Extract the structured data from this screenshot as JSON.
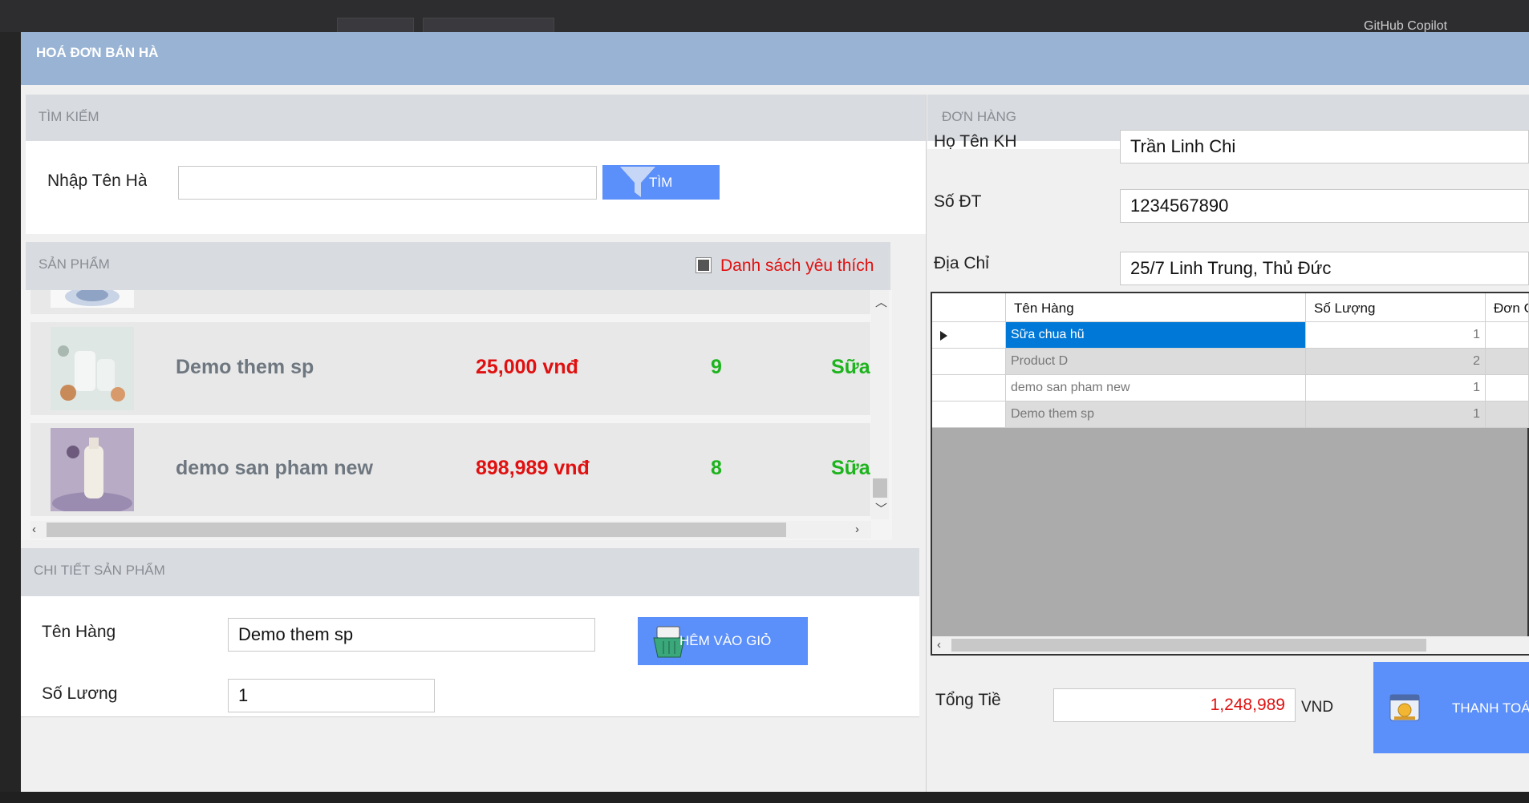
{
  "window": {
    "title": "HOÁ ĐƠN BÁN HÀ"
  },
  "search": {
    "section_title": "TÌM KIẾM",
    "label": "Nhập Tên Hà",
    "input_value": "",
    "button_label": "TÌM"
  },
  "products": {
    "section_title": "SẢN PHẨM",
    "favorites_label": "Danh sách yêu thích",
    "items": [
      {
        "name": "Demo them sp",
        "price": "25,000 vnđ",
        "qty": "9",
        "category": "Sữa"
      },
      {
        "name": "demo san pham new",
        "price": "898,989 vnđ",
        "qty": "8",
        "category": "Sữa"
      }
    ]
  },
  "details": {
    "section_title": "CHI TIẾT SẢN PHẨM",
    "name_label": "Tên Hàng",
    "name_value": "Demo them sp",
    "qty_label": "Số Lương",
    "qty_value": "1",
    "add_button_label": "HÊM VÀO GIỎ"
  },
  "order": {
    "section_title": "ĐƠN HÀNG",
    "customer_label": "Họ Tên KH",
    "customer_value": "Trần Linh Chi",
    "phone_label": "Số ĐT",
    "phone_value": "1234567890",
    "address_label": "Địa Chỉ",
    "address_value": "25/7 Linh Trung, Thủ Đức",
    "grid": {
      "columns": [
        "Tên Hàng",
        "Số Lượng",
        "Đơn G"
      ],
      "rows": [
        {
          "name": "Sữa chua hũ",
          "qty": "1"
        },
        {
          "name": "Product D",
          "qty": "2"
        },
        {
          "name": "demo san pham new",
          "qty": "1"
        },
        {
          "name": "Demo them sp",
          "qty": "1"
        }
      ]
    },
    "total_label": "Tổng Tiề",
    "total_value": "1,248,989",
    "currency": "VND",
    "pay_button_label": "THANH TOÁ"
  },
  "colors": {
    "titlebar": "#98b3d4",
    "accent_button": "#5b8ff9",
    "price_red": "#e01010",
    "qty_green": "#1db31d",
    "grid_selection": "#0078d7"
  },
  "background_toolbar": {
    "copilot_label": "GitHub Copilot"
  }
}
